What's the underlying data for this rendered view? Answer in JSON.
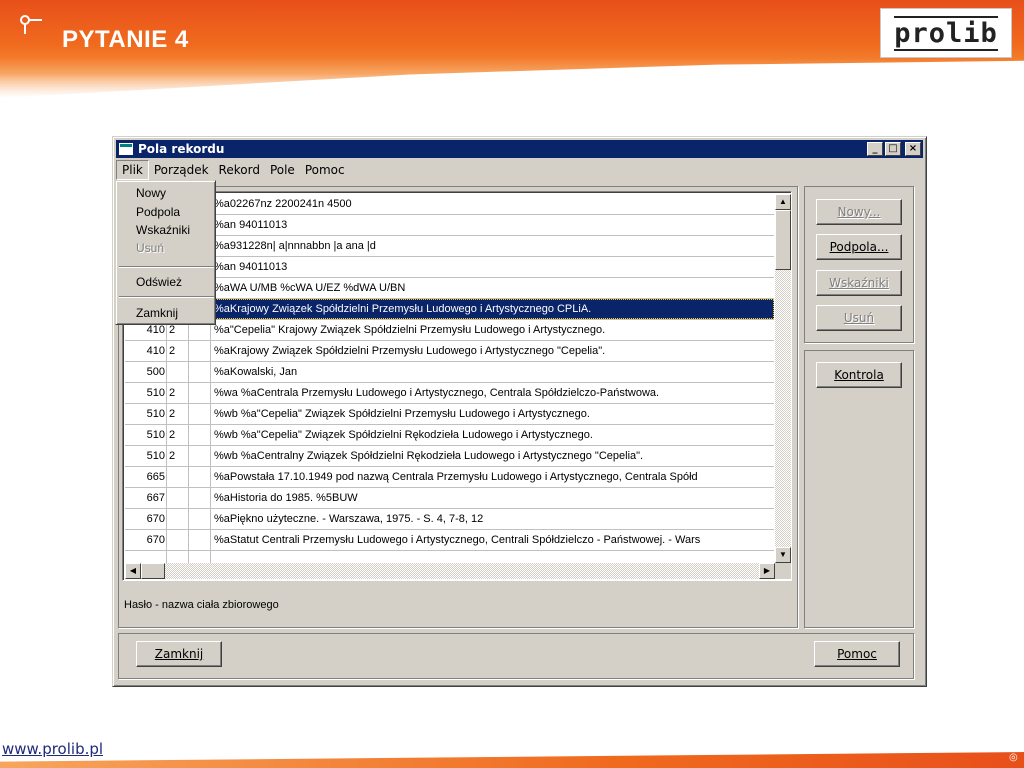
{
  "slide": {
    "title": "PYTANIE 4",
    "logo_text": "prolib",
    "footer_link": "www.prolib.pl"
  },
  "window": {
    "title": "Pola rekordu",
    "minimize": "_",
    "maximize": "□",
    "close": "×"
  },
  "menubar": {
    "items": [
      "Plik",
      "Porządek",
      "Rekord",
      "Pole",
      "Pomoc"
    ]
  },
  "file_menu": {
    "items": [
      {
        "label": "Nowy",
        "enabled": true
      },
      {
        "label": "Podpola",
        "enabled": true
      },
      {
        "label": "Wskaźniki",
        "enabled": true
      },
      {
        "label": "Usuń",
        "enabled": false
      },
      {
        "label": "Odśwież",
        "enabled": true
      },
      {
        "label": "Zamknij",
        "enabled": true
      }
    ]
  },
  "grid": {
    "rows": [
      {
        "tag": "",
        "i1": "",
        "i2": "",
        "value": "%a02267nz   2200241n  4500"
      },
      {
        "tag": "",
        "i1": "",
        "i2": "",
        "value": "%an  94011013"
      },
      {
        "tag": "",
        "i1": "",
        "i2": "",
        "value": "%a931228n| a|nnnabbn         |a ana   |d"
      },
      {
        "tag": "",
        "i1": "",
        "i2": "",
        "value": "%an  94011013"
      },
      {
        "tag": "",
        "i1": "",
        "i2": "",
        "value": "%aWA U/MB %cWA U/EZ %dWA U/BN"
      },
      {
        "tag": "",
        "i1": "",
        "i2": "",
        "value": "%aKrajowy Związek Spółdzielni Przemysłu Ludowego i Artystycznego CPLiA.",
        "selected": true
      },
      {
        "tag": "410",
        "i1": "2",
        "i2": "",
        "value": "%a\"Cepelia\" Krajowy Związek Spółdzielni Przemysłu Ludowego i Artystycznego."
      },
      {
        "tag": "410",
        "i1": "2",
        "i2": "",
        "value": "%aKrajowy Związek Spółdzielni Przemysłu Ludowego i Artystycznego \"Cepelia\"."
      },
      {
        "tag": "500",
        "i1": "",
        "i2": "",
        "value": " %aKowalski, Jan"
      },
      {
        "tag": "510",
        "i1": "2",
        "i2": "",
        "value": "%wa %aCentrala Przemysłu Ludowego i Artystycznego, Centrala Spółdzielczo-Państwowa."
      },
      {
        "tag": "510",
        "i1": "2",
        "i2": "",
        "value": "%wb %a\"Cepelia\" Związek Spółdzielni Przemysłu Ludowego i Artystycznego."
      },
      {
        "tag": "510",
        "i1": "2",
        "i2": "",
        "value": "%wb %a\"Cepelia\" Związek Spółdzielni Rękodzieła Ludowego i Artystycznego."
      },
      {
        "tag": "510",
        "i1": "2",
        "i2": "",
        "value": "%wb %aCentralny Związek Spółdzielni Rękodzieła Ludowego i Artystycznego \"Cepelia\"."
      },
      {
        "tag": "665",
        "i1": "",
        "i2": "",
        "value": "%aPowstała 17.10.1949 pod nazwą Centrala Przemysłu Ludowego i Artystycznego, Centrala Spółd"
      },
      {
        "tag": "667",
        "i1": "",
        "i2": "",
        "value": "%aHistoria do 1985. %5BUW"
      },
      {
        "tag": "670",
        "i1": "",
        "i2": "",
        "value": "%aPiękno użyteczne. - Warszawa, 1975. - S. 4, 7-8, 12"
      },
      {
        "tag": "670",
        "i1": "",
        "i2": "",
        "value": "%aStatut Centrali Przemysłu Ludowego i Artystycznego, Centrali Spółdzielczo - Państwowej. - Wars"
      },
      {
        "tag": "",
        "i1": "",
        "i2": "",
        "value": ""
      }
    ]
  },
  "status_text": "Hasło - nazwa ciała zbiorowego",
  "right_buttons": {
    "nowy": "Nowy...",
    "podpola": "Podpola...",
    "wskazniki": "Wskaźniki",
    "usun": "Usuń",
    "kontrola": "Kontrola"
  },
  "bottom_buttons": {
    "zamknij": "Zamknij",
    "pomoc": "Pomoc"
  }
}
